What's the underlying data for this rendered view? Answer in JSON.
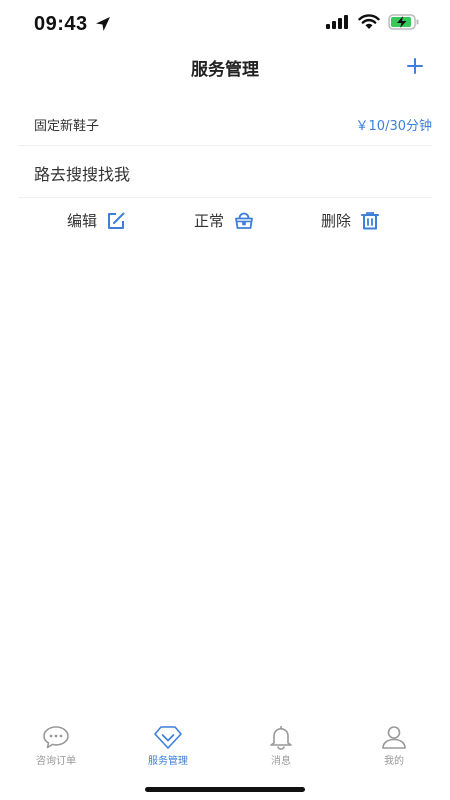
{
  "status_bar": {
    "time": "09:43"
  },
  "nav": {
    "title": "服务管理",
    "add_icon": "plus-icon"
  },
  "service": {
    "name": "固定新鞋子",
    "price": "￥10/30分钟",
    "description": "路去搜搜找我"
  },
  "actions": {
    "edit_label": "编辑",
    "status_label": "正常",
    "delete_label": "删除"
  },
  "tabs": [
    {
      "label": "咨询订单",
      "icon": "chat-bubble-icon",
      "active": false
    },
    {
      "label": "服务管理",
      "icon": "diamond-icon",
      "active": true
    },
    {
      "label": "消息",
      "icon": "bell-icon",
      "active": false
    },
    {
      "label": "我的",
      "icon": "person-icon",
      "active": false
    }
  ],
  "colors": {
    "accent": "#3d7fd9",
    "inactive": "#999999",
    "battery": "#38c759"
  }
}
